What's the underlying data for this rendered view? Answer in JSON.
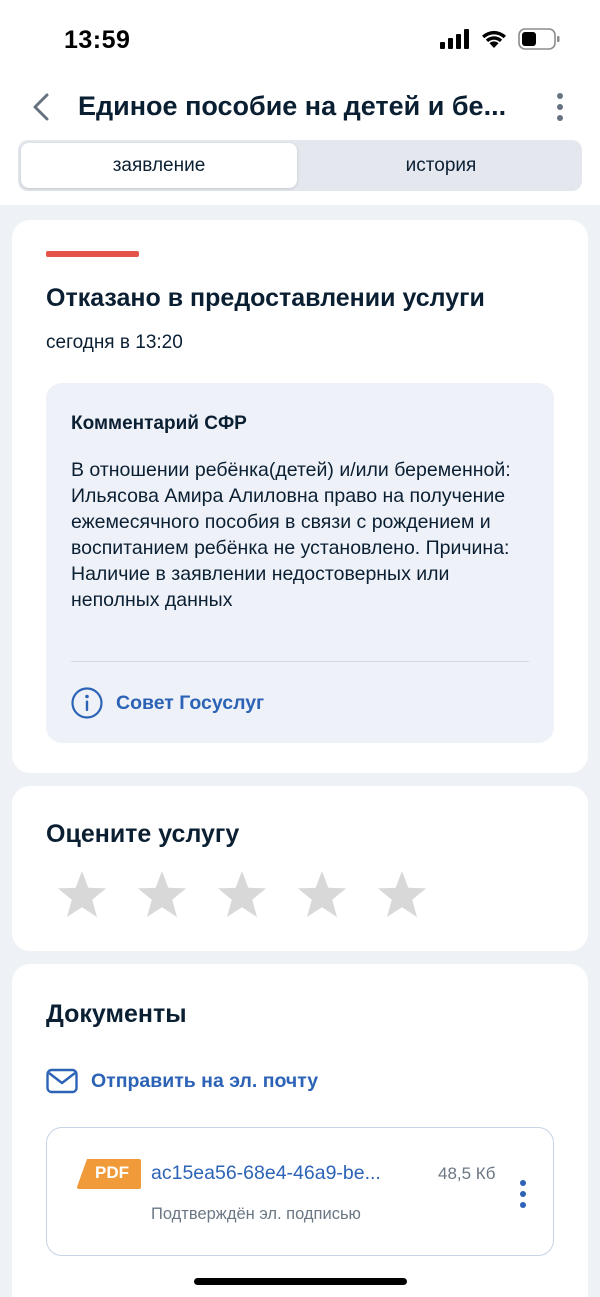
{
  "status_bar": {
    "time": "13:59"
  },
  "header": {
    "title": "Единое пособие на детей и бе..."
  },
  "tabs": [
    {
      "label": "заявление",
      "active": true
    },
    {
      "label": "история",
      "active": false
    }
  ],
  "status_card": {
    "title": "Отказано в предоставлении услуги",
    "date": "сегодня в 13:20",
    "status_color": "#e4544a",
    "comment": {
      "title": "Комментарий СФР",
      "text": "В отношении ребёнка(детей) и/или беременной: Ильясова Амира Алиловна право на получение ежемесячного пособия в связи с рождением и воспитанием ребёнка не установлено. Причина: Наличие в заявлении недостоверных или неполных данных"
    },
    "tip_link": "Совет Госуслуг"
  },
  "rating": {
    "title": "Оцените услугу",
    "stars_total": 5,
    "stars_selected": 0
  },
  "documents": {
    "title": "Документы",
    "email_link": "Отправить на эл. почту",
    "items": [
      {
        "type": "PDF",
        "name": "ac15ea56-68e4-46a9-be...",
        "size": "48,5 Кб",
        "signature": "Подтверждён эл. подписью"
      }
    ]
  },
  "colors": {
    "accent": "#2c63b6",
    "pdf_badge": "#f09a3a",
    "star_inactive": "#d8d8d8"
  }
}
